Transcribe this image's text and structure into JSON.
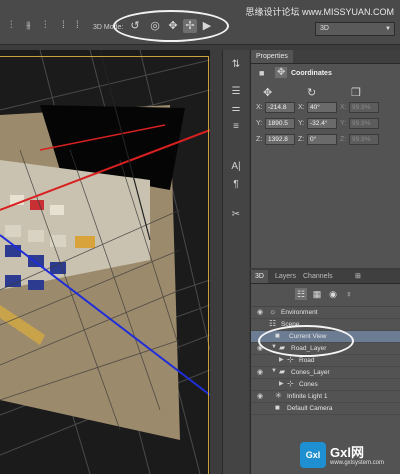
{
  "watermark_top": "思缘设计论坛 www.MISSYUAN.COM",
  "toolbar": {
    "mode_label": "3D Mode:",
    "mode_icons": [
      "rotate-3d-icon",
      "roll-3d-icon",
      "pan-3d-icon",
      "slide-3d-icon",
      "camera-3d-icon"
    ],
    "workspace": "3D"
  },
  "properties": {
    "tab": "Properties",
    "title": "Coordinates",
    "rows": [
      {
        "x": "-214.8",
        "y": "40°",
        "z": "99.9%"
      },
      {
        "x": "1890.5",
        "y": "-32.4°",
        "z": "99.9%"
      },
      {
        "x": "1392.8",
        "y": "0°",
        "z": "99.9%"
      }
    ],
    "axis_x": "X:",
    "axis_y": "Y:",
    "axis_z": "Z:"
  },
  "panel3d": {
    "tabs": [
      "3D",
      "Layers",
      "Channels"
    ],
    "scene_items": [
      {
        "label": "Environment",
        "icon": "environment-icon"
      },
      {
        "label": "Scene",
        "icon": "scene-icon"
      },
      {
        "label": "Current View",
        "icon": "camera-icon"
      },
      {
        "label": "Road_Layer",
        "icon": "mesh-icon"
      },
      {
        "label": "Road",
        "icon": "material-icon"
      },
      {
        "label": "Cones_Layer",
        "icon": "mesh-icon"
      },
      {
        "label": "Cones",
        "icon": "material-icon"
      },
      {
        "label": "Infinite Light 1",
        "icon": "light-icon"
      },
      {
        "label": "Default Camera",
        "icon": "camera-icon"
      }
    ]
  },
  "watermark_bottom": {
    "logo_text": "Gxl",
    "site_text": "Gxl网",
    "url": "www.gxlsystem.com"
  },
  "colors": {
    "frame_border": "#c9a23a",
    "axis_red": "#d92020",
    "axis_blue": "#1f2ed8",
    "selection": "#6b7c93"
  }
}
